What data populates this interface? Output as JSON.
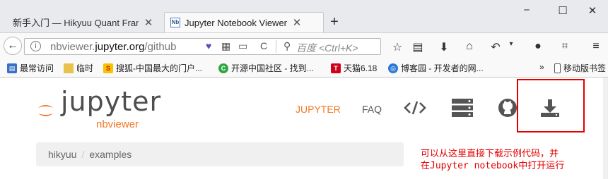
{
  "tabs": [
    {
      "title": "新手入门 — Hikyuu Quant Fram",
      "active": false
    },
    {
      "title": "Jupyter Notebook Viewer",
      "active": true,
      "favicon": "Nb"
    }
  ],
  "window_controls": {
    "minimize": "−",
    "maximize": "☐",
    "close": "✕"
  },
  "navbar": {
    "back": "←",
    "info": "i",
    "url_host": "nbviewer.",
    "url_domain": "jupyter.org",
    "url_path": "/github",
    "reload": "C",
    "search_placeholder": "百度 <Ctrl+K>"
  },
  "bookmarks": [
    {
      "label": "最常访问",
      "icon": "sidebar-icon"
    },
    {
      "label": "临时",
      "icon": "folder-icon"
    },
    {
      "label": "搜狐-中国最大的门户...",
      "icon": "sohu-icon"
    },
    {
      "label": "开源中国社区 - 找到...",
      "icon": "oschina-icon"
    },
    {
      "label": "天猫6.18",
      "icon": "tmall-icon"
    },
    {
      "label": "博客园 - 开发者的网...",
      "icon": "cnblogs-icon"
    }
  ],
  "bookmarks_more": "»",
  "mobile_bookmarks": "移动版书签",
  "page": {
    "logo_text": "jupyter",
    "logo_sub": "nbviewer",
    "nav_jupyter": "JUPYTER",
    "nav_faq": "FAQ",
    "breadcrumb": [
      "hikyuu",
      "examples"
    ],
    "breadcrumb_sep": "/",
    "annotation_line1": "可以从这里直接下载示例代码，并",
    "annotation_line2": "在Jupyter notebook中打开运行"
  },
  "colors": {
    "accent": "#f37726",
    "annotation": "#e50000"
  }
}
